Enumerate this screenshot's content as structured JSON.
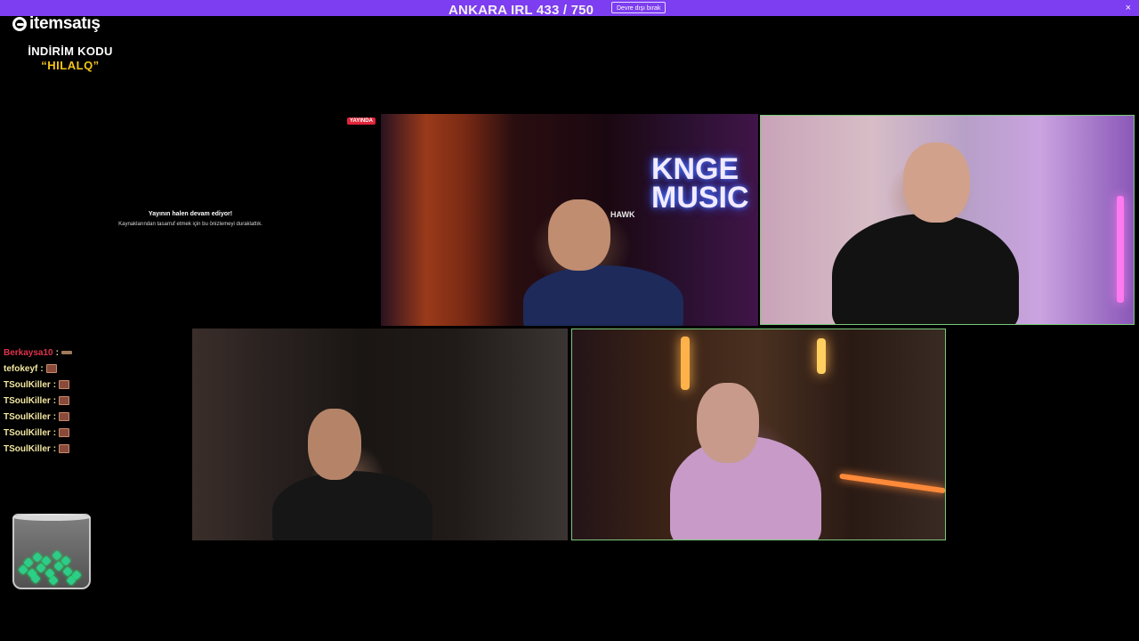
{
  "banner": {
    "notice": "",
    "pause_button": "Devre dışı bırak",
    "close_symbol": "×",
    "color": "#7d3df0"
  },
  "stream_title": "ANKARA IRL 433 / 750",
  "sponsor": {
    "logo_text": "itemsatış",
    "promo_title": "İNDİRİM KODU",
    "promo_code": "“HILALQ”"
  },
  "preview": {
    "live_badge": "YAYINDA",
    "title": "Yayının halen devam ediyor!",
    "subtitle": "Kaynaklarından tasarruf etmek için bu önizlemeyi duraklattık."
  },
  "cameras": {
    "cam1": {
      "neon_sign": "KNGE\nMUSIC",
      "chair_brand": "HAWK"
    }
  },
  "chat": [
    {
      "user": "Berkaysa10",
      "color": "red",
      "emote": "flat"
    },
    {
      "user": "tefokeyf",
      "color": "normal",
      "emote": "box"
    },
    {
      "user": "TSoulKiller",
      "color": "normal",
      "emote": "box"
    },
    {
      "user": "TSoulKiller",
      "color": "normal",
      "emote": "box"
    },
    {
      "user": "TSoulKiller",
      "color": "normal",
      "emote": "box"
    },
    {
      "user": "TSoulKiller",
      "color": "normal",
      "emote": "box"
    },
    {
      "user": "TSoulKiller",
      "color": "normal",
      "emote": "box"
    }
  ],
  "chat_separator": ":"
}
